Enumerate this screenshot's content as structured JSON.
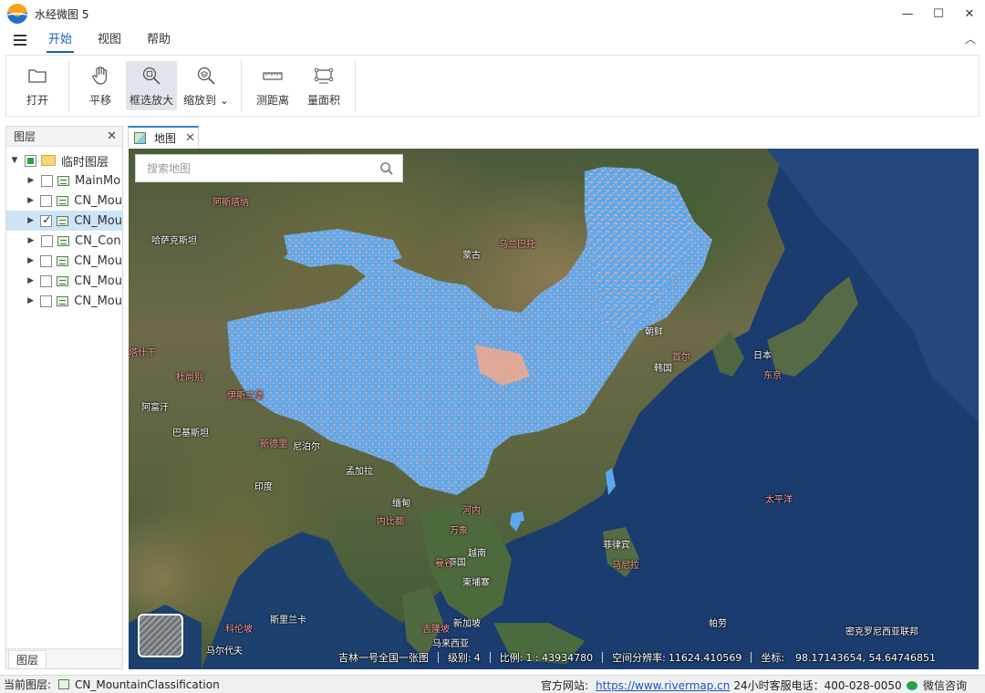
{
  "window": {
    "title": "水经微图 5",
    "controls": {
      "minimize": "—",
      "maximize": "☐",
      "close": "✕"
    }
  },
  "ribbon_tabs": [
    {
      "label": "开始",
      "active": true
    },
    {
      "label": "视图",
      "active": false
    },
    {
      "label": "帮助",
      "active": false
    }
  ],
  "ribbon": {
    "collapse_glyph": "︿",
    "buttons": [
      {
        "label": "打开",
        "icon": "folder-open-icon"
      },
      {
        "label": "平移",
        "icon": "hand-pan-icon"
      },
      {
        "label": "框选放大",
        "icon": "zoom-box-icon",
        "selected": true
      },
      {
        "label": "缩放到",
        "icon": "zoom-to-layers-icon",
        "dropdown": "⌄"
      },
      {
        "label": "测距离",
        "icon": "ruler-icon"
      },
      {
        "label": "量面积",
        "icon": "area-measure-icon"
      }
    ]
  },
  "layers_panel": {
    "title": "图层",
    "close_glyph": "✕",
    "root": {
      "label": "临时图层",
      "expand_glyph": "▼"
    },
    "items": [
      {
        "label": "MainMo",
        "checked": false
      },
      {
        "label": "CN_Mou",
        "checked": false
      },
      {
        "label": "CN_Mou",
        "checked": true,
        "selected": true
      },
      {
        "label": "CN_Con",
        "checked": false
      },
      {
        "label": "CN_Mou",
        "checked": false
      },
      {
        "label": "CN_Mou",
        "checked": false
      },
      {
        "label": "CN_Mou",
        "checked": false
      }
    ],
    "collapse_glyph": "▶",
    "bottom_tab": "图层"
  },
  "map_tab": {
    "label": "地图",
    "close_glyph": "✕"
  },
  "map": {
    "search_placeholder": "搜索地图",
    "labels": {
      "white": [
        "哈萨克斯坦",
        "蒙古",
        "朝鲜",
        "韩国",
        "日本",
        "阿富汗",
        "巴基斯坦",
        "尼泊尔",
        "孟加拉",
        "印度",
        "缅甸",
        "泰国",
        "柬埔寨",
        "越南",
        "菲律宾",
        "马来西亚",
        "新加坡",
        "斯里兰卡",
        "马尔代夫",
        "帕劳",
        "密克罗尼西亚联邦"
      ],
      "pink": [
        "阿斯塔纳",
        "乌兰巴托",
        "塔什干",
        "杜尚别",
        "伊斯兰堡",
        "新德里",
        "首尔",
        "东京",
        "内比都",
        "万象",
        "河内",
        "曼谷",
        "马尼拉",
        "科伦坡",
        "吉隆坡",
        "太平洋"
      ]
    },
    "status": {
      "source": "吉林一号全国一张图",
      "level_label": "级别:",
      "level": "4",
      "scale_label": "比例:",
      "scale": "1 : 43934780",
      "resolution_label": "空间分辨率:",
      "resolution": "11624.410569",
      "coord_label": "坐标:",
      "lon": "98.17143654",
      "lat": "54.64746851"
    },
    "overlay_color": "#5aa9f0",
    "overlay_accent": "#f2a98d"
  },
  "statusbar": {
    "current_layer_label": "当前图层:",
    "current_layer": "CN_MountainClassification",
    "website_label": "官方网站:",
    "website_url": "https://www.rivermap.cn",
    "hotline": "24小时客服电话：400-028-0050",
    "wechat": "微信咨询"
  }
}
